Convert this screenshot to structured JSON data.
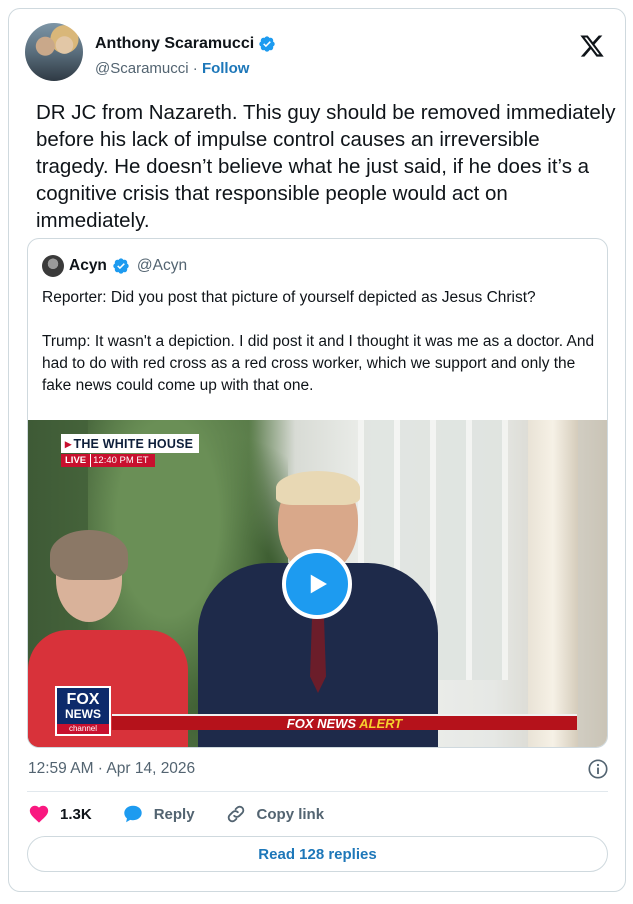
{
  "author": {
    "name": "Anthony Scaramucci",
    "handle": "@Scaramucci",
    "separator": "·",
    "follow_label": "Follow"
  },
  "tweet": {
    "text": "DR JC from Nazareth.  This guy should be removed immediately before his lack of impulse control causes an irreversible tragedy. He doesn’t believe what he just said, if he does it’s a cognitive crisis that responsible people would act on immediately."
  },
  "quote": {
    "name": "Acyn",
    "handle": "@Acyn",
    "paragraphs": [
      "Reporter: Did you post that picture of yourself depicted as Jesus Christ?",
      "Trump: It wasn't a depiction. I did post it and I thought it was me as a doctor. And had to do with red cross as a red cross worker, which we support and only the fake news could come up with that one."
    ],
    "video": {
      "chyron_label": "THE WHITE HOUSE",
      "live_label": "LIVE",
      "time_label": "12:40 PM ET",
      "logo_fox": "FOX",
      "logo_news": "NEWS",
      "logo_channel": "channel",
      "alert_prefix": "FOX NEWS",
      "alert_word": "ALERT"
    }
  },
  "timestamp": "12:59 AM · Apr 14, 2026",
  "actions": {
    "likes": "1.3K",
    "reply_label": "Reply",
    "copy_label": "Copy link"
  },
  "read_replies": "Read 128 replies",
  "colors": {
    "accent": "#1d9bf0",
    "link": "#1d77b9",
    "like": "#f91880",
    "border": "#cfd9de"
  }
}
